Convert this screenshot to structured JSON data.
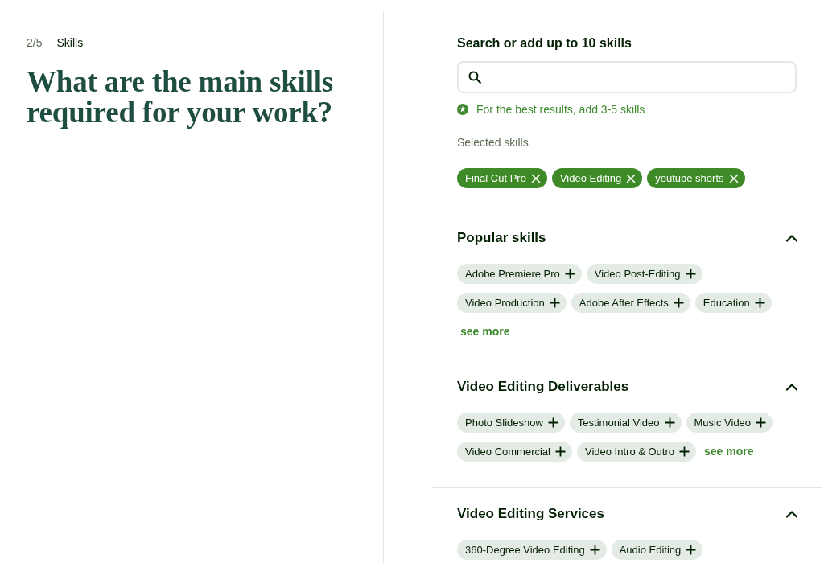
{
  "step": {
    "counter": "2/5",
    "label": "Skills"
  },
  "question": "What are the main skills required for your work?",
  "search": {
    "label": "Search or add up to 10 skills",
    "hint": "For the best results, add 3-5 skills"
  },
  "selected_skills": {
    "label": "Selected skills",
    "skills": [
      "Final Cut Pro",
      "Video Editing",
      "youtube shorts"
    ]
  },
  "sections": [
    {
      "title": "Popular skills",
      "expanded": true,
      "divided": false,
      "skills": [
        "Adobe Premiere Pro",
        "Video Post-Editing",
        "Video Production",
        "Adobe After Effects",
        "Education"
      ],
      "see_more": "see more"
    },
    {
      "title": "Video Editing Deliverables",
      "expanded": true,
      "divided": false,
      "skills": [
        "Photo Slideshow",
        "Testimonial Video",
        "Music Video",
        "Video Commercial",
        "Video Intro & Outro"
      ],
      "see_more": "see more"
    },
    {
      "title": "Video Editing Services",
      "expanded": true,
      "divided": true,
      "skills": [
        "360-Degree Video Editing",
        "Audio Editing"
      ]
    }
  ]
}
